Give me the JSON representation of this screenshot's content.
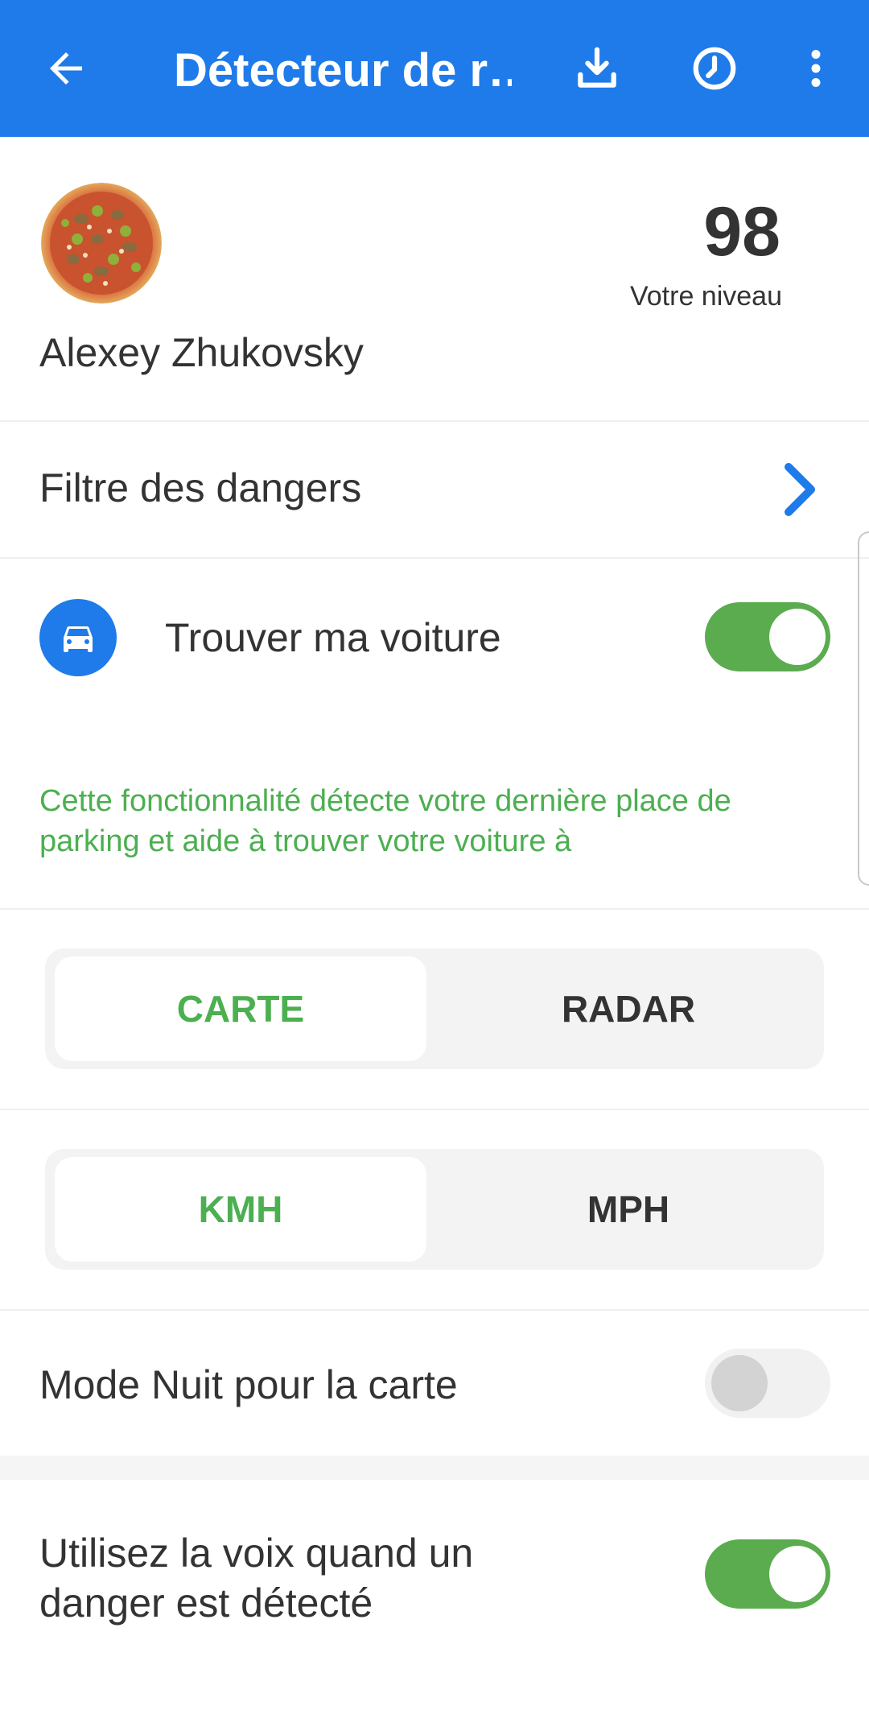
{
  "appbar": {
    "title": "Détecteur de r…",
    "background_color": "#1e7be9",
    "icons": [
      "back-arrow-icon",
      "download-icon",
      "clock-icon",
      "more-vert-icon"
    ]
  },
  "profile": {
    "name": "Alexey Zhukovsky",
    "level_value": "98",
    "level_label": "Votre niveau",
    "avatar": "pizza-avatar"
  },
  "hazard_filter": {
    "label": "Filtre des dangers",
    "icon": "chevron-right-icon"
  },
  "find_car": {
    "label": "Trouver ma voiture",
    "icon": "car-icon",
    "enabled": true,
    "description": "Cette fonctionnalité détecte votre dernière place de parking et aide à trouver votre voiture à"
  },
  "view_mode": {
    "options": [
      "CARTE",
      "RADAR"
    ],
    "selected": "CARTE"
  },
  "speed_unit": {
    "options": [
      "KMH",
      "MPH"
    ],
    "selected": "KMH"
  },
  "night_mode": {
    "label": "Mode Nuit pour la carte",
    "enabled": false
  },
  "voice_alert": {
    "label": "Utilisez la voix quand un danger est détecté",
    "enabled": true
  },
  "colors": {
    "accent_blue": "#1e7be9",
    "accent_green": "#4caf50",
    "toggle_on": "#5aac4e",
    "text_dark": "#333333"
  }
}
